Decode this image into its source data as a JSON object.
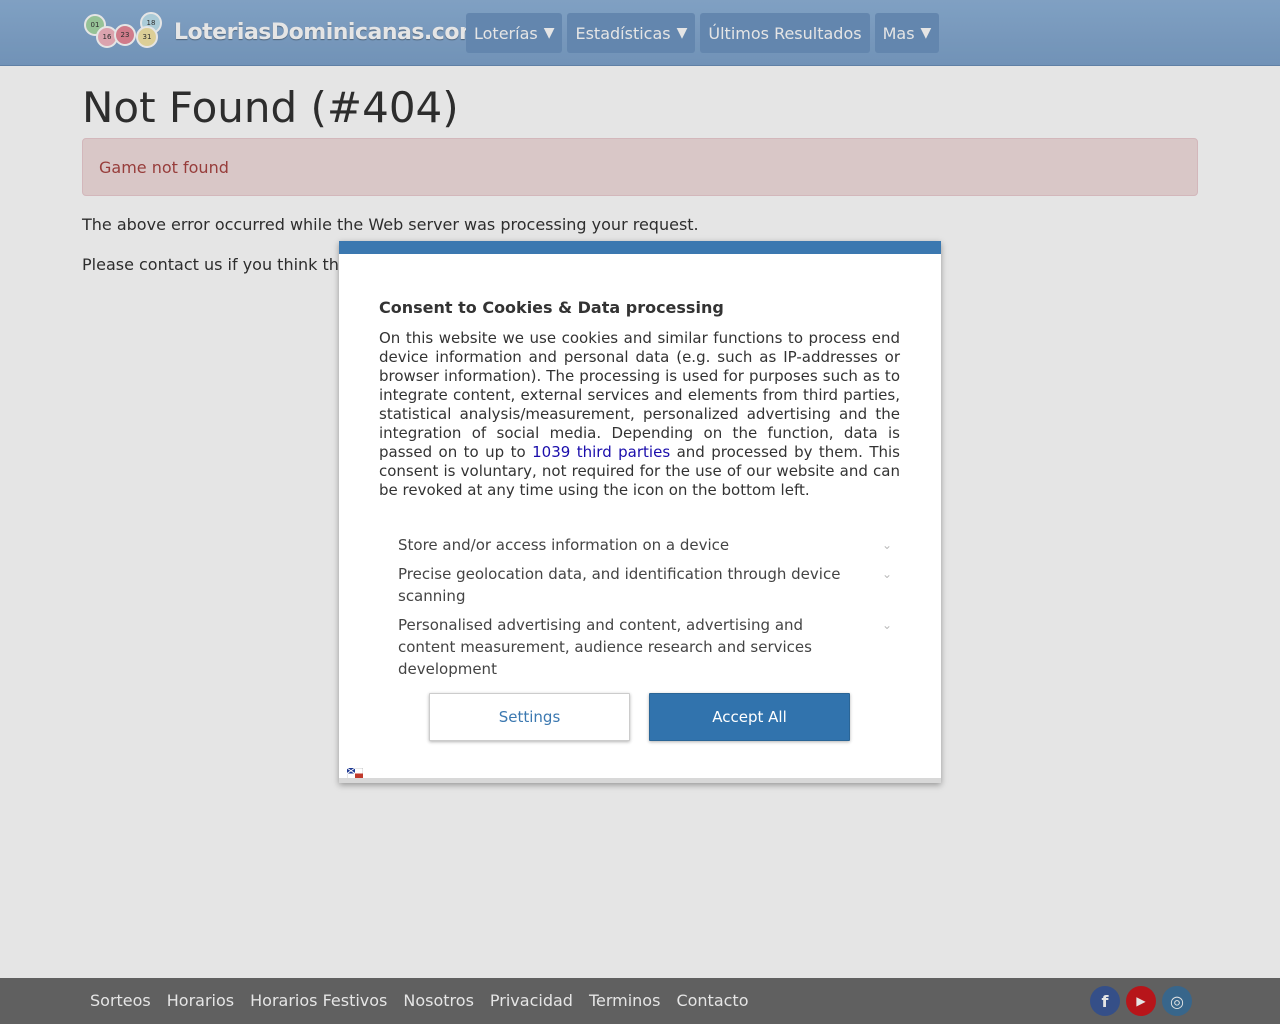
{
  "header": {
    "logo_text": "LoteriasDominicanas.com",
    "logo_ball_numbers": [
      "01",
      "16",
      "23",
      "18",
      "31"
    ],
    "nav": [
      {
        "label": "Loterías",
        "has_caret": true
      },
      {
        "label": "Estadísticas",
        "has_caret": true
      },
      {
        "label": "Últimos Resultados",
        "has_caret": false
      },
      {
        "label": "Mas",
        "has_caret": true
      }
    ],
    "caret_glyph": "▼"
  },
  "main": {
    "title": "Not Found (#404)",
    "alert": "Game not found",
    "para1": "The above error occurred while the Web server was processing your request.",
    "para2": "Please contact us if you think th"
  },
  "consent": {
    "title": "Consent to Cookies & Data processing",
    "body_before_link": "On this website we use cookies and similar functions to process end device information and personal data (e.g. such as IP-addresses or browser information). The processing is used for purposes such as to integrate content, external services and elements from third parties, statistical analysis/measurement, personalized advertising and the integration of social media. Depending on the function, data is passed on to up to ",
    "link_text": "1039 third parties",
    "body_after_link": " and processed by them. This consent is voluntary, not required for the use of our website and can be revoked at any time using the icon on the bottom left.",
    "purposes": [
      "Store and/or access information on a device",
      "Precise geolocation data, and identification through device scanning",
      "Personalised advertising and content, advertising and content measurement, audience research and services development"
    ],
    "settings_label": "Settings",
    "accept_label": "Accept All",
    "accent_color": "#3173ad"
  },
  "footer": {
    "links": [
      "Sorteos",
      "Horarios",
      "Horarios Festivos",
      "Nosotros",
      "Privacidad",
      "Terminos",
      "Contacto"
    ],
    "social": [
      {
        "name": "facebook-icon",
        "glyph": "f"
      },
      {
        "name": "youtube-icon",
        "glyph": "▶"
      },
      {
        "name": "instagram-icon",
        "glyph": "◎"
      }
    ]
  }
}
